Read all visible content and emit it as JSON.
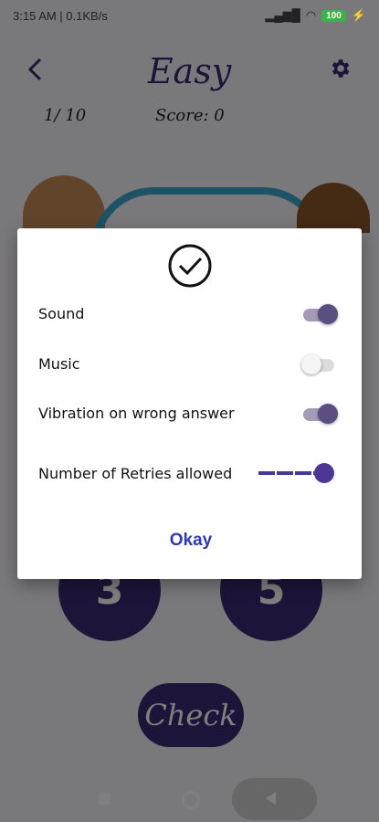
{
  "status_bar": {
    "time": "3:15 AM | 0.1KB/s",
    "battery": "100"
  },
  "header": {
    "title": "Easy",
    "progress": "1/ 10",
    "score": "Score: 0",
    "back_icon": "chevron-left-icon",
    "settings_icon": "gear-icon"
  },
  "answers": {
    "left": "3",
    "right": "5"
  },
  "check_button": {
    "label": "Check"
  },
  "dialog": {
    "icon": "check-circle-icon",
    "settings": [
      {
        "label": "Sound",
        "enabled": true
      },
      {
        "label": "Music",
        "enabled": false
      },
      {
        "label": "Vibration on wrong answer",
        "enabled": true
      }
    ],
    "retries": {
      "label": "Number of Retries allowed",
      "value_fraction": 0.8
    },
    "okay_label": "Okay"
  },
  "colors": {
    "primary": "#3b2a72",
    "accent": "#4c3796",
    "dialog_button": "#2e3bb0"
  }
}
